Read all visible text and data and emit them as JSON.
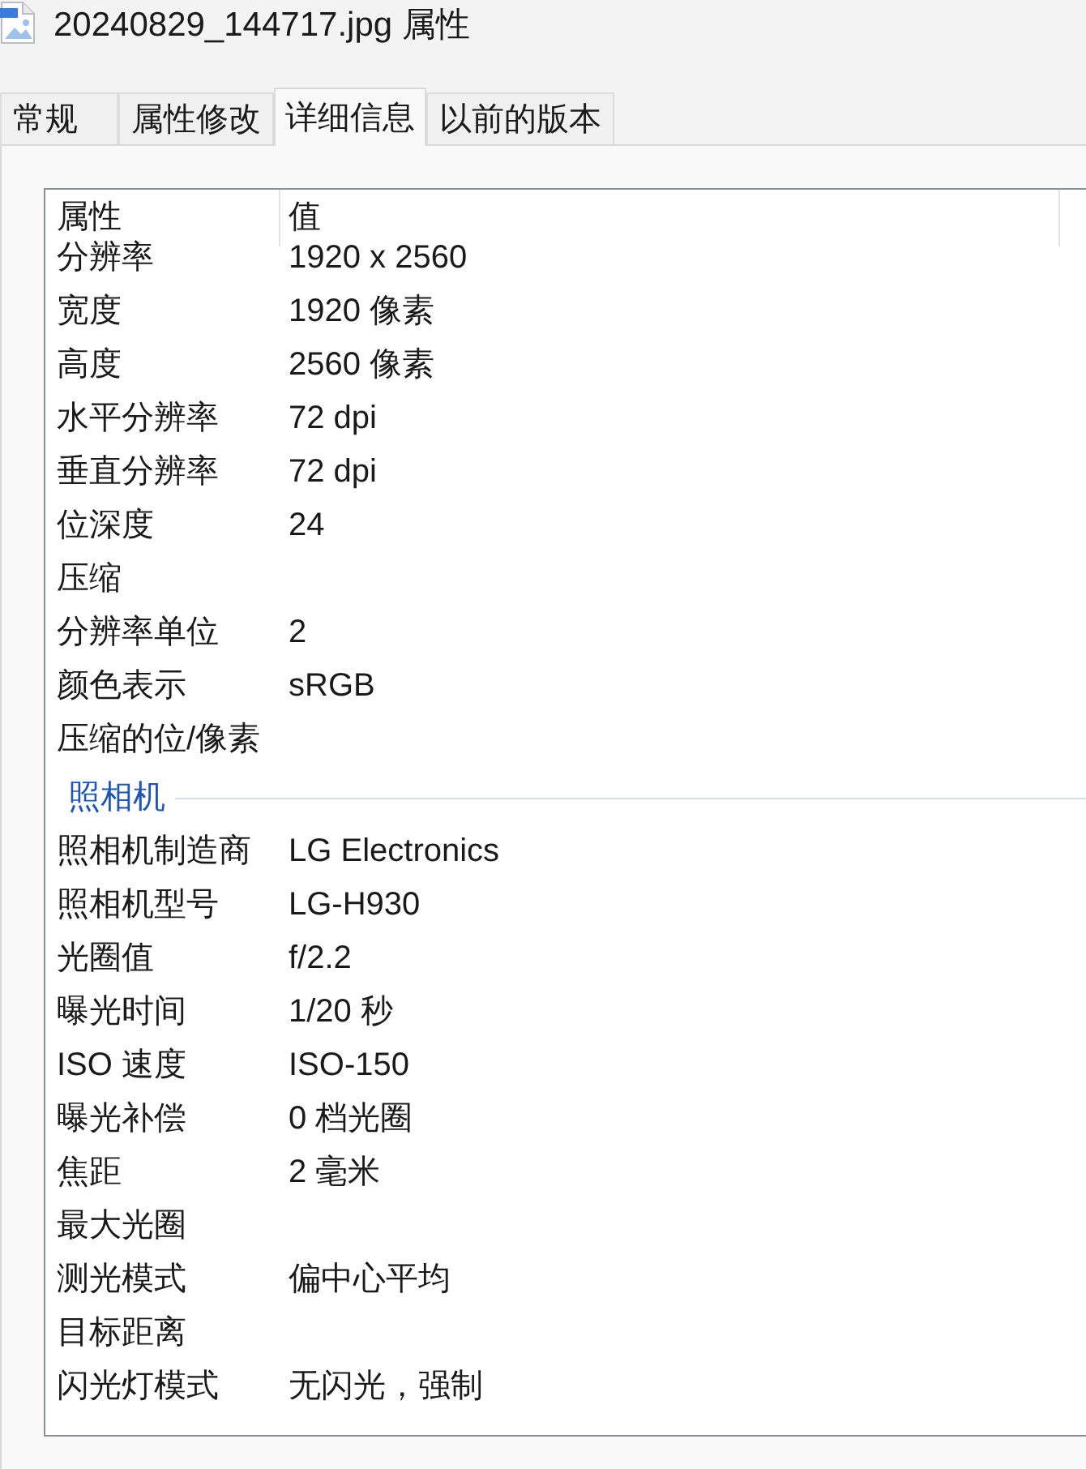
{
  "window": {
    "title": "20240829_144717.jpg 属性"
  },
  "tabs": [
    {
      "label": "常规",
      "selected": false
    },
    {
      "label": "属性修改",
      "selected": false
    },
    {
      "label": "详细信息",
      "selected": true
    },
    {
      "label": "以前的版本",
      "selected": false
    }
  ],
  "details": {
    "columns": [
      "属性",
      "值"
    ],
    "groups": [
      {
        "rows": [
          {
            "property": "分辨率",
            "value": "1920 x 2560"
          },
          {
            "property": "宽度",
            "value": "1920 像素"
          },
          {
            "property": "高度",
            "value": "2560 像素"
          },
          {
            "property": "水平分辨率",
            "value": "72 dpi"
          },
          {
            "property": "垂直分辨率",
            "value": "72 dpi"
          },
          {
            "property": "位深度",
            "value": "24"
          },
          {
            "property": "压缩"
          },
          {
            "property": "分辨率单位",
            "value": "2"
          },
          {
            "property": "颜色表示",
            "value": "sRGB"
          },
          {
            "property": "压缩的位/像素"
          }
        ]
      },
      {
        "heading": "照相机",
        "rows": [
          {
            "property": "照相机制造商",
            "value": "LG Electronics"
          },
          {
            "property": "照相机型号",
            "value": "LG-H930"
          },
          {
            "property": "光圈值",
            "value": "f/2.2"
          },
          {
            "property": "曝光时间",
            "value": "1/20 秒"
          },
          {
            "property": "ISO 速度",
            "value": "ISO-150"
          },
          {
            "property": "曝光补偿",
            "value": "0 档光圈"
          },
          {
            "property": "焦距",
            "value": "2 毫米"
          },
          {
            "property": "最大光圈"
          },
          {
            "property": "测光模式",
            "value": "偏中心平均"
          },
          {
            "property": "目标距离"
          },
          {
            "property": "闪光灯模式",
            "value": "无闪光，强制"
          }
        ]
      }
    ]
  }
}
